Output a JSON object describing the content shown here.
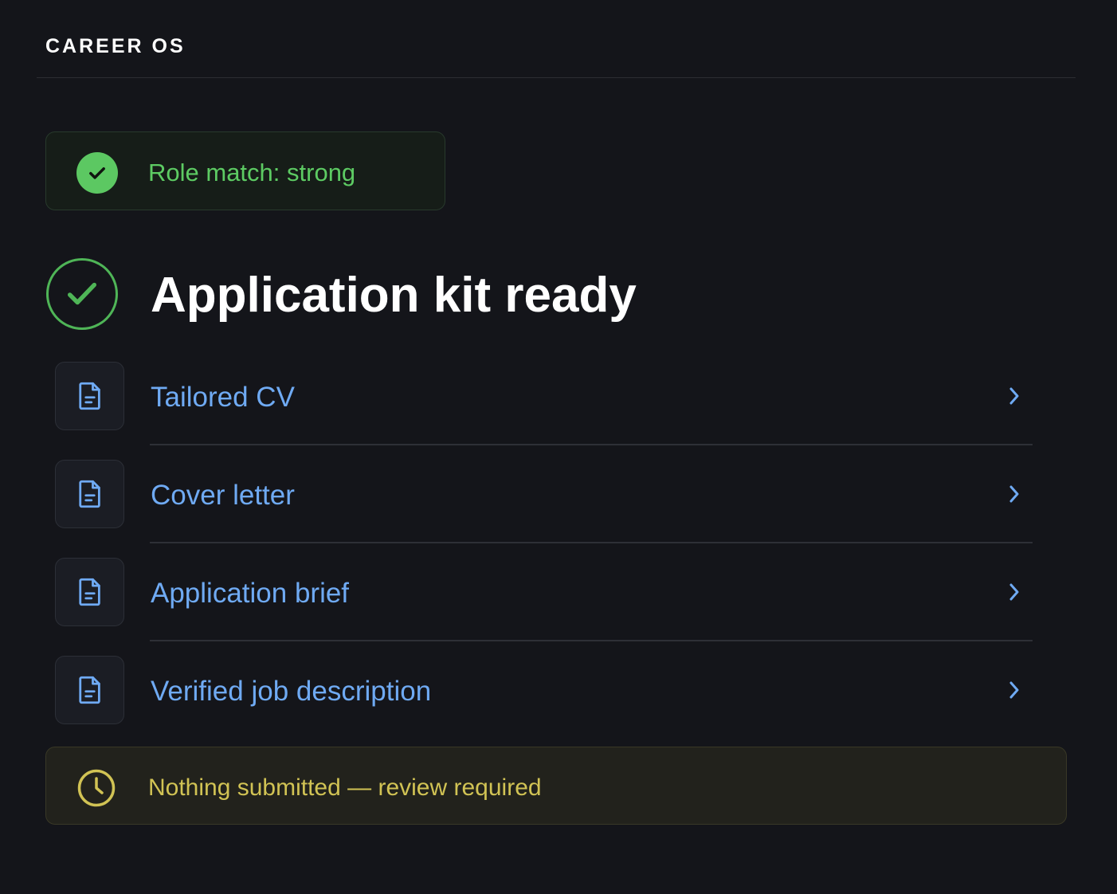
{
  "app": {
    "title": "CAREER OS"
  },
  "match": {
    "label": "Role match: strong",
    "icon": "check-circle-icon",
    "color": "#5cc862"
  },
  "status": {
    "headline": "Application kit ready",
    "icon": "check-ring-icon",
    "color": "#4fb557"
  },
  "kit": {
    "items": [
      {
        "label": "Tailored CV",
        "icon": "document-icon"
      },
      {
        "label": "Cover letter",
        "icon": "document-icon"
      },
      {
        "label": "Application brief",
        "icon": "document-icon"
      },
      {
        "label": "Verified job description",
        "icon": "document-icon"
      }
    ],
    "link_color": "#6faaf3"
  },
  "notice": {
    "label": "Nothing submitted — review required",
    "icon": "clock-icon",
    "color": "#d1c354"
  }
}
